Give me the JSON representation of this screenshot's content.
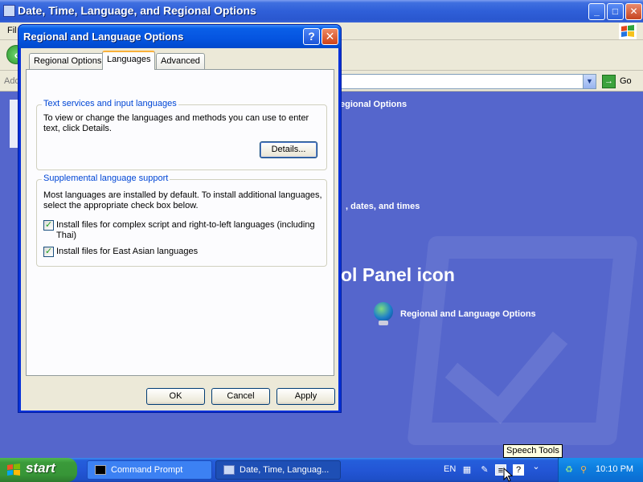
{
  "background_window": {
    "title": "Date, Time, Language, and Regional Options",
    "menu_partial": "Fil",
    "address_label": "Add",
    "go_label": "Go",
    "breadcrumb_partial": "egional Options",
    "task_partial": ", dates, and times",
    "heading_partial": "ol Panel icon",
    "cp_item_label": "Regional and Language Options",
    "title_buttons": {
      "minimize": "_",
      "maximize": "□",
      "close": "✕"
    }
  },
  "dialog": {
    "title": "Regional and Language Options",
    "help_button": "?",
    "close_button": "✕",
    "tabs": [
      {
        "label": "Regional Options",
        "active": false
      },
      {
        "label": "Languages",
        "active": true
      },
      {
        "label": "Advanced",
        "active": false
      }
    ],
    "text_services": {
      "legend": "Text services and input languages",
      "description_line1": "To view or change the languages and methods you can use to enter",
      "description_line2": "text, click Details.",
      "details_button": "Details..."
    },
    "supplemental": {
      "legend": "Supplemental language support",
      "description_line1": "Most languages are installed by default. To install additional languages,",
      "description_line2": "select the appropriate check box below.",
      "checkboxes": [
        {
          "label_line1": "Install files for complex script and right-to-left languages (including",
          "label_line2": "Thai)",
          "checked": true
        },
        {
          "label_line1": "Install files for East Asian languages",
          "label_line2": "",
          "checked": true
        }
      ]
    },
    "buttons": {
      "ok": "OK",
      "cancel": "Cancel",
      "apply": "Apply"
    }
  },
  "taskbar": {
    "start_label": "start",
    "items": [
      {
        "label": "Command Prompt",
        "active": false
      },
      {
        "label": "Date, Time, Languag...",
        "active": true
      }
    ],
    "language_indicator": "EN",
    "clock": "10:10 PM"
  },
  "tooltip": "Speech Tools",
  "colors": {
    "titlebar_blue": "#0554e0",
    "dialog_face": "#ece9d8",
    "group_legend": "#0046d5",
    "start_green": "#3a9a3a",
    "taskbar_blue": "#245edb",
    "desktop_blue": "#5566cc"
  },
  "icons": [
    "control-panel-icon",
    "xp-flag-icon",
    "back-arrow-icon",
    "go-arrow-icon",
    "help-icon",
    "close-icon",
    "windows-logo-icon",
    "command-prompt-icon",
    "folder-icon",
    "keyboard-icon",
    "pen-icon",
    "speech-tools-icon",
    "help-tray-icon",
    "network-icon",
    "search-tray-icon",
    "globe-icon",
    "mouse-cursor-icon"
  ]
}
